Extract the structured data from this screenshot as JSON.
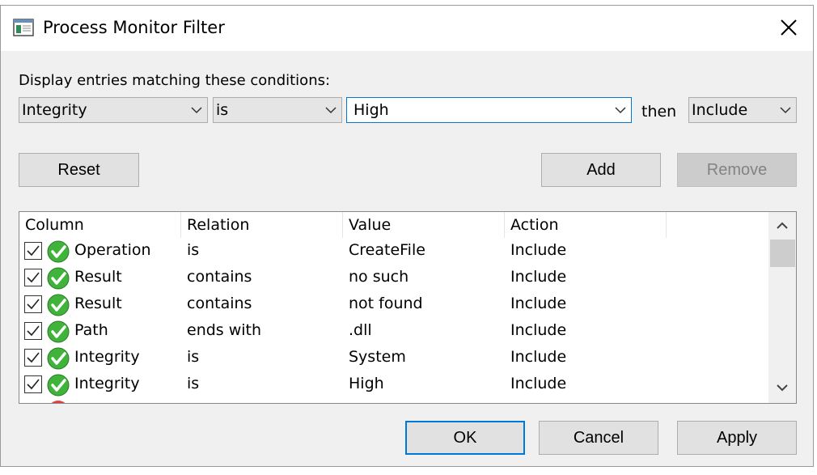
{
  "dialog": {
    "title": "Process Monitor Filter",
    "prompt": "Display entries matching these conditions:"
  },
  "condition": {
    "column": "Integrity",
    "relation": "is",
    "value": "High",
    "then_label": "then",
    "action": "Include"
  },
  "buttons": {
    "reset": "Reset",
    "add": "Add",
    "remove": "Remove",
    "ok": "OK",
    "cancel": "Cancel",
    "apply": "Apply"
  },
  "table": {
    "headers": [
      "Column",
      "Relation",
      "Value",
      "Action"
    ],
    "rows": [
      {
        "column": "Operation",
        "relation": "is",
        "value": "CreateFile",
        "action": "Include"
      },
      {
        "column": "Result",
        "relation": "contains",
        "value": "no such",
        "action": "Include"
      },
      {
        "column": "Result",
        "relation": "contains",
        "value": "not found",
        "action": "Include"
      },
      {
        "column": "Path",
        "relation": "ends with",
        "value": ".dll",
        "action": "Include"
      },
      {
        "column": "Integrity",
        "relation": "is",
        "value": "System",
        "action": "Include"
      },
      {
        "column": "Integrity",
        "relation": "is",
        "value": "High",
        "action": "Include"
      }
    ]
  },
  "colors": {
    "accent": "#0078d7",
    "include_icon": "#3fb33a",
    "exclude_icon": "#e04040"
  }
}
